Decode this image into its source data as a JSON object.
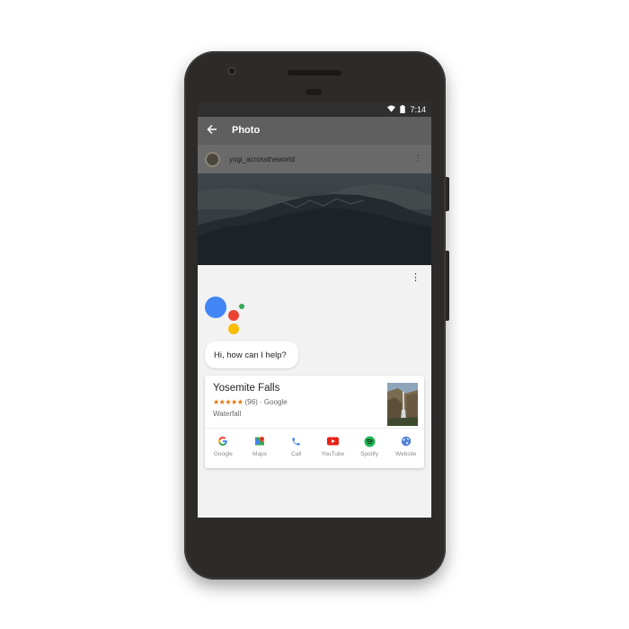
{
  "status": {
    "time": "7:14",
    "icons": [
      "wifi-icon",
      "battery-icon"
    ]
  },
  "appbar": {
    "back_icon": "arrow-back-icon",
    "title": "Photo"
  },
  "post": {
    "username": "yogi_acrosstheworld",
    "more_icon": "more-vert-icon"
  },
  "assistant": {
    "greeting": "Hi, how can I help?",
    "dots_colors": [
      "#4285F4",
      "#EA4335",
      "#34A853",
      "#FBBC05"
    ],
    "more_icon": "more-vert-icon"
  },
  "card": {
    "title": "Yosemite Falls",
    "stars": "★★★★★",
    "rating_text": "(96) · Google",
    "type": "Waterfall",
    "actions": [
      {
        "label": "Google",
        "icon": "google-icon"
      },
      {
        "label": "Maps",
        "icon": "maps-icon"
      },
      {
        "label": "Call",
        "icon": "phone-icon"
      },
      {
        "label": "YouTube",
        "icon": "youtube-icon"
      },
      {
        "label": "Spotify",
        "icon": "spotify-icon"
      },
      {
        "label": "Website",
        "icon": "globe-icon"
      }
    ]
  },
  "navbar": {
    "icons": [
      "back-triangle-icon",
      "home-circle-icon",
      "recents-square-icon"
    ]
  },
  "colors": {
    "phone_body": "#2c2b29",
    "scrim": "#5f5f5f",
    "star": "#e8710a"
  }
}
